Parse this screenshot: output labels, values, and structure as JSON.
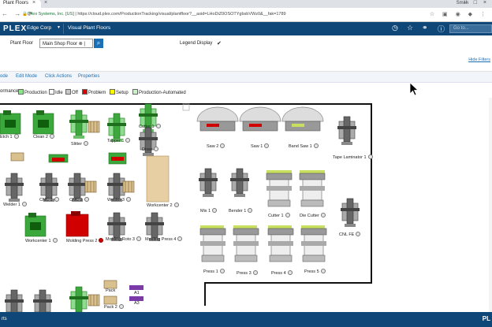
{
  "browser": {
    "tab_title": "Plant Floors",
    "profile": "Smith",
    "url_secure": "Plex Systems, Inc. [US]",
    "url": "https://cloud.plex.com/ProductionTracking/visual/plantfloor?__asid=LHoDiZ0OSOTYgbsbVWz0&__fak=1789"
  },
  "header": {
    "logo": "PLEX",
    "company": "Edge Corp",
    "title": "Visual Plant Floors",
    "goto_placeholder": "Go to..."
  },
  "filter": {
    "plant_floor_label": "Plant Floor",
    "plant_floor_value": "Main Shop Floor ⊗ |",
    "legend_label": "Legend Display",
    "legend_checked": "✔",
    "hide_filters": "Hide Filters"
  },
  "modes": [
    "ode",
    "Edit Mode",
    "Click Actions",
    "Properties"
  ],
  "legend": [
    {
      "label": "ormance",
      "color": ""
    },
    {
      "label": "Production",
      "color": "#8fe58f"
    },
    {
      "label": "Idle",
      "color": "#ffffff"
    },
    {
      "label": "Off",
      "color": "#c8c8c8"
    },
    {
      "label": "Problem",
      "color": "#e00000"
    },
    {
      "label": "Setup",
      "color": "#ffff00"
    },
    {
      "label": "Production-Automated",
      "color": "#c6f5c6"
    }
  ],
  "equipment": {
    "etch1": "Etch 1",
    "clean2": "Clean 2",
    "slitter": "Slitter",
    "tapper1": "Tapper 1",
    "cutter1a": "Cutter 1",
    "draw": "Draw",
    "saw2": "Saw 2",
    "saw1": "Saw 1",
    "bandsaw1": "Band Saw 1",
    "tapelaminator1": "Tape Laminator 1",
    "welder1": "Welder 1",
    "cnc1": "CNC 1",
    "cnc2": "CNC 2",
    "welder3": "Welder 3",
    "workcenter2": "Workcenter 2",
    "mix1": "Mix 1",
    "bender1": "Bender 1",
    "cutter1b": "Cutter 1",
    "diecutter": "Die Cutter",
    "cnlfe": "CNL FE",
    "workcenter1": "Workcenter 1",
    "moldingpress2": "Molding Press 2",
    "moldingroto3": "Molding Roto 3",
    "moldingpress4": "Molding Press 4",
    "press1": "Press 1",
    "press3": "Press 3",
    "press4": "Press 4",
    "press5": "Press 5",
    "pack": "Pack",
    "pack2": "Pack 2",
    "a1": "A1",
    "a3": "A3"
  },
  "status": {
    "left": "rts",
    "logo": "PL"
  },
  "colors": {
    "header": "#0f4878",
    "link": "#1a6fb5",
    "production": "#56c256",
    "problem": "#d00000"
  }
}
